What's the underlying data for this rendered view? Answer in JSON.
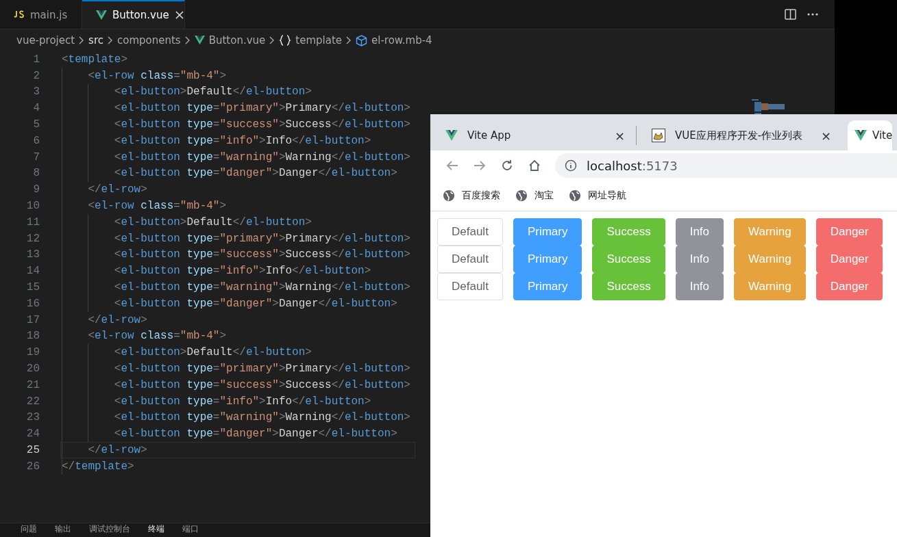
{
  "editor": {
    "tabs": [
      {
        "kind": "js",
        "label": "main.js",
        "selected": false
      },
      {
        "kind": "vue",
        "label": "Button.vue",
        "selected": true
      }
    ],
    "breadcrumb": [
      {
        "kind": "plain",
        "label": "vue-project"
      },
      {
        "kind": "plain",
        "label": "src"
      },
      {
        "kind": "plain",
        "label": "components"
      },
      {
        "kind": "vue",
        "label": "Button.vue"
      },
      {
        "kind": "braces",
        "label": "template"
      },
      {
        "kind": "cube",
        "label": "el-row.mb-4"
      }
    ],
    "lines": [
      {
        "number": "1",
        "current": false,
        "tokens": [
          {
            "kind": "punct",
            "text": "<"
          },
          {
            "kind": "tag",
            "text": "template"
          },
          {
            "kind": "punct",
            "text": ">"
          }
        ]
      },
      {
        "number": "2",
        "current": false,
        "tokens": [
          {
            "kind": "punct",
            "text": "    <"
          },
          {
            "kind": "tag",
            "text": "el-row"
          },
          {
            "kind": "attr",
            "text": " class"
          },
          {
            "kind": "punct",
            "text": "="
          },
          {
            "kind": "string",
            "text": "\"mb-4\""
          },
          {
            "kind": "punct",
            "text": ">"
          }
        ]
      },
      {
        "number": "3",
        "current": false,
        "tokens": [
          {
            "kind": "punct",
            "text": "        <"
          },
          {
            "kind": "tag",
            "text": "el-button"
          },
          {
            "kind": "punct",
            "text": ">"
          },
          {
            "kind": "text",
            "text": "Default"
          },
          {
            "kind": "punct",
            "text": "</"
          },
          {
            "kind": "tag",
            "text": "el-button"
          },
          {
            "kind": "punct",
            "text": ">"
          }
        ]
      },
      {
        "number": "4",
        "current": false,
        "tokens": [
          {
            "kind": "punct",
            "text": "        <"
          },
          {
            "kind": "tag",
            "text": "el-button"
          },
          {
            "kind": "attr",
            "text": " type"
          },
          {
            "kind": "punct",
            "text": "="
          },
          {
            "kind": "string",
            "text": "\"primary\""
          },
          {
            "kind": "punct",
            "text": ">"
          },
          {
            "kind": "text",
            "text": "Primary"
          },
          {
            "kind": "punct",
            "text": "</"
          },
          {
            "kind": "tag",
            "text": "el-button"
          },
          {
            "kind": "punct",
            "text": ">"
          }
        ]
      },
      {
        "number": "5",
        "current": false,
        "tokens": [
          {
            "kind": "punct",
            "text": "        <"
          },
          {
            "kind": "tag",
            "text": "el-button"
          },
          {
            "kind": "attr",
            "text": " type"
          },
          {
            "kind": "punct",
            "text": "="
          },
          {
            "kind": "string",
            "text": "\"success\""
          },
          {
            "kind": "punct",
            "text": ">"
          },
          {
            "kind": "text",
            "text": "Success"
          },
          {
            "kind": "punct",
            "text": "</"
          },
          {
            "kind": "tag",
            "text": "el-button"
          },
          {
            "kind": "punct",
            "text": ">"
          }
        ]
      },
      {
        "number": "6",
        "current": false,
        "tokens": [
          {
            "kind": "punct",
            "text": "        <"
          },
          {
            "kind": "tag",
            "text": "el-button"
          },
          {
            "kind": "attr",
            "text": " type"
          },
          {
            "kind": "punct",
            "text": "="
          },
          {
            "kind": "string",
            "text": "\"info\""
          },
          {
            "kind": "punct",
            "text": ">"
          },
          {
            "kind": "text",
            "text": "Info"
          },
          {
            "kind": "punct",
            "text": "</"
          },
          {
            "kind": "tag",
            "text": "el-button"
          },
          {
            "kind": "punct",
            "text": ">"
          }
        ]
      },
      {
        "number": "7",
        "current": false,
        "tokens": [
          {
            "kind": "punct",
            "text": "        <"
          },
          {
            "kind": "tag",
            "text": "el-button"
          },
          {
            "kind": "attr",
            "text": " type"
          },
          {
            "kind": "punct",
            "text": "="
          },
          {
            "kind": "string",
            "text": "\"warning\""
          },
          {
            "kind": "punct",
            "text": ">"
          },
          {
            "kind": "text",
            "text": "Warning"
          },
          {
            "kind": "punct",
            "text": "</"
          },
          {
            "kind": "tag",
            "text": "el-button"
          },
          {
            "kind": "punct",
            "text": ">"
          }
        ]
      },
      {
        "number": "8",
        "current": false,
        "tokens": [
          {
            "kind": "punct",
            "text": "        <"
          },
          {
            "kind": "tag",
            "text": "el-button"
          },
          {
            "kind": "attr",
            "text": " type"
          },
          {
            "kind": "punct",
            "text": "="
          },
          {
            "kind": "string",
            "text": "\"danger\""
          },
          {
            "kind": "punct",
            "text": ">"
          },
          {
            "kind": "text",
            "text": "Danger"
          },
          {
            "kind": "punct",
            "text": "</"
          },
          {
            "kind": "tag",
            "text": "el-button"
          },
          {
            "kind": "punct",
            "text": ">"
          }
        ]
      },
      {
        "number": "9",
        "current": false,
        "tokens": [
          {
            "kind": "punct",
            "text": "    </"
          },
          {
            "kind": "tag",
            "text": "el-row"
          },
          {
            "kind": "punct",
            "text": ">"
          }
        ]
      },
      {
        "number": "10",
        "current": false,
        "tokens": [
          {
            "kind": "punct",
            "text": "    <"
          },
          {
            "kind": "tag",
            "text": "el-row"
          },
          {
            "kind": "attr",
            "text": " class"
          },
          {
            "kind": "punct",
            "text": "="
          },
          {
            "kind": "string",
            "text": "\"mb-4\""
          },
          {
            "kind": "punct",
            "text": ">"
          }
        ]
      },
      {
        "number": "11",
        "current": false,
        "tokens": [
          {
            "kind": "punct",
            "text": "        <"
          },
          {
            "kind": "tag",
            "text": "el-button"
          },
          {
            "kind": "punct",
            "text": ">"
          },
          {
            "kind": "text",
            "text": "Default"
          },
          {
            "kind": "punct",
            "text": "</"
          },
          {
            "kind": "tag",
            "text": "el-button"
          },
          {
            "kind": "punct",
            "text": ">"
          }
        ]
      },
      {
        "number": "12",
        "current": false,
        "tokens": [
          {
            "kind": "punct",
            "text": "        <"
          },
          {
            "kind": "tag",
            "text": "el-button"
          },
          {
            "kind": "attr",
            "text": " type"
          },
          {
            "kind": "punct",
            "text": "="
          },
          {
            "kind": "string",
            "text": "\"primary\""
          },
          {
            "kind": "punct",
            "text": ">"
          },
          {
            "kind": "text",
            "text": "Primary"
          },
          {
            "kind": "punct",
            "text": "</"
          },
          {
            "kind": "tag",
            "text": "el-button"
          },
          {
            "kind": "punct",
            "text": ">"
          }
        ]
      },
      {
        "number": "13",
        "current": false,
        "tokens": [
          {
            "kind": "punct",
            "text": "        <"
          },
          {
            "kind": "tag",
            "text": "el-button"
          },
          {
            "kind": "attr",
            "text": " type"
          },
          {
            "kind": "punct",
            "text": "="
          },
          {
            "kind": "string",
            "text": "\"success\""
          },
          {
            "kind": "punct",
            "text": ">"
          },
          {
            "kind": "text",
            "text": "Success"
          },
          {
            "kind": "punct",
            "text": "</"
          },
          {
            "kind": "tag",
            "text": "el-button"
          },
          {
            "kind": "punct",
            "text": ">"
          }
        ]
      },
      {
        "number": "14",
        "current": false,
        "tokens": [
          {
            "kind": "punct",
            "text": "        <"
          },
          {
            "kind": "tag",
            "text": "el-button"
          },
          {
            "kind": "attr",
            "text": " type"
          },
          {
            "kind": "punct",
            "text": "="
          },
          {
            "kind": "string",
            "text": "\"info\""
          },
          {
            "kind": "punct",
            "text": ">"
          },
          {
            "kind": "text",
            "text": "Info"
          },
          {
            "kind": "punct",
            "text": "</"
          },
          {
            "kind": "tag",
            "text": "el-button"
          },
          {
            "kind": "punct",
            "text": ">"
          }
        ]
      },
      {
        "number": "15",
        "current": false,
        "tokens": [
          {
            "kind": "punct",
            "text": "        <"
          },
          {
            "kind": "tag",
            "text": "el-button"
          },
          {
            "kind": "attr",
            "text": " type"
          },
          {
            "kind": "punct",
            "text": "="
          },
          {
            "kind": "string",
            "text": "\"warning\""
          },
          {
            "kind": "punct",
            "text": ">"
          },
          {
            "kind": "text",
            "text": "Warning"
          },
          {
            "kind": "punct",
            "text": "</"
          },
          {
            "kind": "tag",
            "text": "el-button"
          },
          {
            "kind": "punct",
            "text": ">"
          }
        ]
      },
      {
        "number": "16",
        "current": false,
        "tokens": [
          {
            "kind": "punct",
            "text": "        <"
          },
          {
            "kind": "tag",
            "text": "el-button"
          },
          {
            "kind": "attr",
            "text": " type"
          },
          {
            "kind": "punct",
            "text": "="
          },
          {
            "kind": "string",
            "text": "\"danger\""
          },
          {
            "kind": "punct",
            "text": ">"
          },
          {
            "kind": "text",
            "text": "Danger"
          },
          {
            "kind": "punct",
            "text": "</"
          },
          {
            "kind": "tag",
            "text": "el-button"
          },
          {
            "kind": "punct",
            "text": ">"
          }
        ]
      },
      {
        "number": "17",
        "current": false,
        "tokens": [
          {
            "kind": "punct",
            "text": "    </"
          },
          {
            "kind": "tag",
            "text": "el-row"
          },
          {
            "kind": "punct",
            "text": ">"
          }
        ]
      },
      {
        "number": "18",
        "current": false,
        "tokens": [
          {
            "kind": "punct",
            "text": "    <"
          },
          {
            "kind": "tag",
            "text": "el-row"
          },
          {
            "kind": "attr",
            "text": " class"
          },
          {
            "kind": "punct",
            "text": "="
          },
          {
            "kind": "string",
            "text": "\"mb-4\""
          },
          {
            "kind": "punct",
            "text": ">"
          }
        ]
      },
      {
        "number": "19",
        "current": false,
        "tokens": [
          {
            "kind": "punct",
            "text": "        <"
          },
          {
            "kind": "tag",
            "text": "el-button"
          },
          {
            "kind": "punct",
            "text": ">"
          },
          {
            "kind": "text",
            "text": "Default"
          },
          {
            "kind": "punct",
            "text": "</"
          },
          {
            "kind": "tag",
            "text": "el-button"
          },
          {
            "kind": "punct",
            "text": ">"
          }
        ]
      },
      {
        "number": "20",
        "current": false,
        "tokens": [
          {
            "kind": "punct",
            "text": "        <"
          },
          {
            "kind": "tag",
            "text": "el-button"
          },
          {
            "kind": "attr",
            "text": " type"
          },
          {
            "kind": "punct",
            "text": "="
          },
          {
            "kind": "string",
            "text": "\"primary\""
          },
          {
            "kind": "punct",
            "text": ">"
          },
          {
            "kind": "text",
            "text": "Primary"
          },
          {
            "kind": "punct",
            "text": "</"
          },
          {
            "kind": "tag",
            "text": "el-button"
          },
          {
            "kind": "punct",
            "text": ">"
          }
        ]
      },
      {
        "number": "21",
        "current": false,
        "tokens": [
          {
            "kind": "punct",
            "text": "        <"
          },
          {
            "kind": "tag",
            "text": "el-button"
          },
          {
            "kind": "attr",
            "text": " type"
          },
          {
            "kind": "punct",
            "text": "="
          },
          {
            "kind": "string",
            "text": "\"success\""
          },
          {
            "kind": "punct",
            "text": ">"
          },
          {
            "kind": "text",
            "text": "Success"
          },
          {
            "kind": "punct",
            "text": "</"
          },
          {
            "kind": "tag",
            "text": "el-button"
          },
          {
            "kind": "punct",
            "text": ">"
          }
        ]
      },
      {
        "number": "22",
        "current": false,
        "tokens": [
          {
            "kind": "punct",
            "text": "        <"
          },
          {
            "kind": "tag",
            "text": "el-button"
          },
          {
            "kind": "attr",
            "text": " type"
          },
          {
            "kind": "punct",
            "text": "="
          },
          {
            "kind": "string",
            "text": "\"info\""
          },
          {
            "kind": "punct",
            "text": ">"
          },
          {
            "kind": "text",
            "text": "Info"
          },
          {
            "kind": "punct",
            "text": "</"
          },
          {
            "kind": "tag",
            "text": "el-button"
          },
          {
            "kind": "punct",
            "text": ">"
          }
        ]
      },
      {
        "number": "23",
        "current": false,
        "tokens": [
          {
            "kind": "punct",
            "text": "        <"
          },
          {
            "kind": "tag",
            "text": "el-button"
          },
          {
            "kind": "attr",
            "text": " type"
          },
          {
            "kind": "punct",
            "text": "="
          },
          {
            "kind": "string",
            "text": "\"warning\""
          },
          {
            "kind": "punct",
            "text": ">"
          },
          {
            "kind": "text",
            "text": "Warning"
          },
          {
            "kind": "punct",
            "text": "</"
          },
          {
            "kind": "tag",
            "text": "el-button"
          },
          {
            "kind": "punct",
            "text": ">"
          }
        ]
      },
      {
        "number": "24",
        "current": false,
        "tokens": [
          {
            "kind": "punct",
            "text": "        <"
          },
          {
            "kind": "tag",
            "text": "el-button"
          },
          {
            "kind": "attr",
            "text": " type"
          },
          {
            "kind": "punct",
            "text": "="
          },
          {
            "kind": "string",
            "text": "\"danger\""
          },
          {
            "kind": "punct",
            "text": ">"
          },
          {
            "kind": "text",
            "text": "Danger"
          },
          {
            "kind": "punct",
            "text": "</"
          },
          {
            "kind": "tag",
            "text": "el-button"
          },
          {
            "kind": "punct",
            "text": ">"
          }
        ]
      },
      {
        "number": "25",
        "current": true,
        "tokens": [
          {
            "kind": "punct",
            "text": "    </"
          },
          {
            "kind": "tag",
            "text": "el-row"
          },
          {
            "kind": "punct",
            "text": ">"
          }
        ]
      },
      {
        "number": "26",
        "current": false,
        "tokens": [
          {
            "kind": "punct",
            "text": "</"
          },
          {
            "kind": "tag",
            "text": "template"
          },
          {
            "kind": "punct",
            "text": ">"
          }
        ]
      }
    ],
    "panel_tabs": [
      {
        "label": "问题",
        "selected": false
      },
      {
        "label": "输出",
        "selected": false
      },
      {
        "label": "调试控制台",
        "selected": false
      },
      {
        "label": "终端",
        "selected": true
      },
      {
        "label": "端口",
        "selected": false
      }
    ]
  },
  "browser": {
    "tabs": [
      {
        "kind": "vue",
        "title": "Vite App",
        "selected": false,
        "close": "×"
      },
      {
        "kind": "cat",
        "title": "VUE应用程序开发-作业列表",
        "selected": false,
        "close": "×"
      },
      {
        "kind": "vue",
        "title": "Vite",
        "selected": true
      }
    ],
    "address": {
      "host": "localhost",
      "port": ":5173"
    },
    "bookmarks": [
      "百度搜索",
      "淘宝",
      "网址导航"
    ],
    "button_rows": [
      {
        "buttons": [
          {
            "kind": "default",
            "label": "Default"
          },
          {
            "kind": "primary",
            "label": "Primary"
          },
          {
            "kind": "success",
            "label": "Success"
          },
          {
            "kind": "info",
            "label": "Info"
          },
          {
            "kind": "warning",
            "label": "Warning"
          },
          {
            "kind": "danger",
            "label": "Danger"
          }
        ]
      },
      {
        "buttons": [
          {
            "kind": "default",
            "label": "Default"
          },
          {
            "kind": "primary",
            "label": "Primary"
          },
          {
            "kind": "success",
            "label": "Success"
          },
          {
            "kind": "info",
            "label": "Info"
          },
          {
            "kind": "warning",
            "label": "Warning"
          },
          {
            "kind": "danger",
            "label": "Danger"
          }
        ]
      },
      {
        "buttons": [
          {
            "kind": "default",
            "label": "Default"
          },
          {
            "kind": "primary",
            "label": "Primary"
          },
          {
            "kind": "success",
            "label": "Success"
          },
          {
            "kind": "info",
            "label": "Info"
          },
          {
            "kind": "warning",
            "label": "Warning"
          },
          {
            "kind": "danger",
            "label": "Danger"
          }
        ]
      }
    ]
  }
}
